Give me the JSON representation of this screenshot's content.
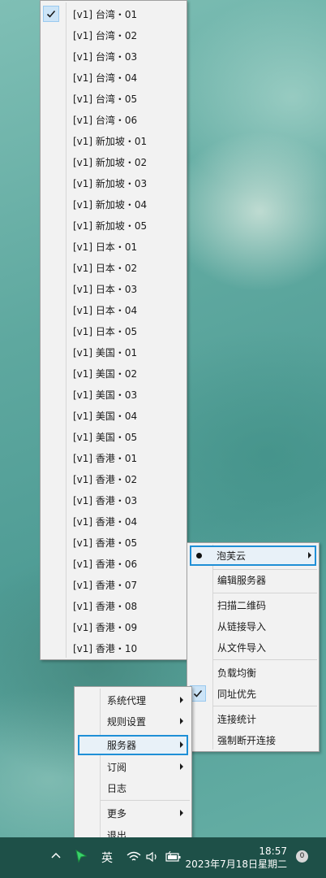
{
  "server_list": [
    {
      "label": "[v1] 台湾・01",
      "checked": true
    },
    {
      "label": "[v1] 台湾・02"
    },
    {
      "label": "[v1] 台湾・03"
    },
    {
      "label": "[v1] 台湾・04"
    },
    {
      "label": "[v1] 台湾・05"
    },
    {
      "label": "[v1] 台湾・06"
    },
    {
      "label": "[v1] 新加坡・01"
    },
    {
      "label": "[v1] 新加坡・02"
    },
    {
      "label": "[v1] 新加坡・03"
    },
    {
      "label": "[v1] 新加坡・04"
    },
    {
      "label": "[v1] 新加坡・05"
    },
    {
      "label": "[v1] 日本・01"
    },
    {
      "label": "[v1] 日本・02"
    },
    {
      "label": "[v1] 日本・03"
    },
    {
      "label": "[v1] 日本・04"
    },
    {
      "label": "[v1] 日本・05"
    },
    {
      "label": "[v1] 美国・01"
    },
    {
      "label": "[v1] 美国・02"
    },
    {
      "label": "[v1] 美国・03"
    },
    {
      "label": "[v1] 美国・04"
    },
    {
      "label": "[v1] 美国・05"
    },
    {
      "label": "[v1] 香港・01"
    },
    {
      "label": "[v1] 香港・02"
    },
    {
      "label": "[v1] 香港・03"
    },
    {
      "label": "[v1] 香港・04"
    },
    {
      "label": "[v1] 香港・05"
    },
    {
      "label": "[v1] 香港・06"
    },
    {
      "label": "[v1] 香港・07"
    },
    {
      "label": "[v1] 香港・08"
    },
    {
      "label": "[v1] 香港・09"
    },
    {
      "label": "[v1] 香港・10"
    }
  ],
  "servers_menu": {
    "group": "泡芙云",
    "edit": "编辑服务器",
    "scan_qr": "扫描二维码",
    "import_link": "从链接导入",
    "import_file": "从文件导入",
    "load_balance": "负载均衡",
    "same_host_first": "同址优先",
    "conn_stats": "连接统计",
    "force_disconnect": "强制断开连接"
  },
  "main_menu": {
    "system_proxy": "系统代理",
    "rule_settings": "规则设置",
    "servers": "服务器",
    "subscriptions": "订阅",
    "logs": "日志",
    "more": "更多",
    "quit": "退出"
  },
  "taskbar": {
    "ime": "英",
    "time": "18:57",
    "date": "2023年7月18日星期二",
    "notif_count": "0"
  },
  "colors": {
    "highlight_border": "#1f8fd6",
    "check_bg": "#cce4f7",
    "menu_bg": "#f2f2f2"
  }
}
